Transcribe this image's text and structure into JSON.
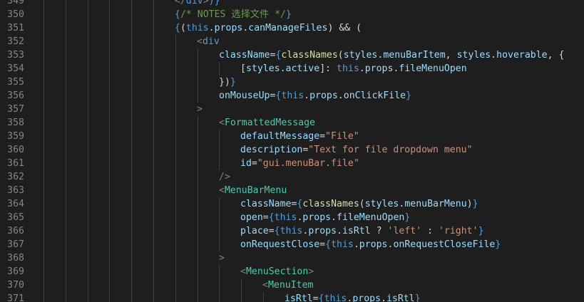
{
  "editor": {
    "lines": [
      {
        "num": "349",
        "indent": 6,
        "tokens": [
          {
            "t": "</",
            "c": "tagp"
          },
          {
            "t": "div",
            "c": "kw"
          },
          {
            "t": ">",
            "c": "tagp"
          },
          {
            "t": ")}",
            "c": "brace"
          }
        ]
      },
      {
        "num": "350",
        "indent": 6,
        "tokens": [
          {
            "t": "{",
            "c": "brace"
          },
          {
            "t": "/* NOTES 选择文件 */",
            "c": "comment"
          },
          {
            "t": "}",
            "c": "brace"
          }
        ]
      },
      {
        "num": "351",
        "indent": 6,
        "tokens": [
          {
            "t": "{",
            "c": "brace"
          },
          {
            "t": "(",
            "c": "paren"
          },
          {
            "t": "this",
            "c": "kw"
          },
          {
            "t": ".",
            "c": "punct"
          },
          {
            "t": "props",
            "c": "prop"
          },
          {
            "t": ".",
            "c": "punct"
          },
          {
            "t": "canManageFiles",
            "c": "prop"
          },
          {
            "t": ")",
            "c": "paren"
          },
          {
            "t": " && (",
            "c": "op"
          }
        ]
      },
      {
        "num": "352",
        "indent": 7,
        "tokens": [
          {
            "t": "<",
            "c": "tagp"
          },
          {
            "t": "div",
            "c": "kw"
          }
        ]
      },
      {
        "num": "353",
        "indent": 8,
        "tokens": [
          {
            "t": "className",
            "c": "attr"
          },
          {
            "t": "=",
            "c": "op"
          },
          {
            "t": "{",
            "c": "brace"
          },
          {
            "t": "classNames",
            "c": "func"
          },
          {
            "t": "(",
            "c": "paren"
          },
          {
            "t": "styles",
            "c": "prop"
          },
          {
            "t": ".",
            "c": "punct"
          },
          {
            "t": "menuBarItem",
            "c": "prop"
          },
          {
            "t": ", ",
            "c": "punct"
          },
          {
            "t": "styles",
            "c": "prop"
          },
          {
            "t": ".",
            "c": "punct"
          },
          {
            "t": "hoverable",
            "c": "prop"
          },
          {
            "t": ", {",
            "c": "punct"
          }
        ]
      },
      {
        "num": "354",
        "indent": 9,
        "tokens": [
          {
            "t": "[",
            "c": "punct"
          },
          {
            "t": "styles",
            "c": "prop"
          },
          {
            "t": ".",
            "c": "punct"
          },
          {
            "t": "active",
            "c": "prop"
          },
          {
            "t": "]: ",
            "c": "punct"
          },
          {
            "t": "this",
            "c": "kw"
          },
          {
            "t": ".",
            "c": "punct"
          },
          {
            "t": "props",
            "c": "prop"
          },
          {
            "t": ".",
            "c": "punct"
          },
          {
            "t": "fileMenuOpen",
            "c": "prop"
          }
        ]
      },
      {
        "num": "355",
        "indent": 8,
        "tokens": [
          {
            "t": "})",
            "c": "punct"
          },
          {
            "t": "}",
            "c": "brace"
          }
        ]
      },
      {
        "num": "356",
        "indent": 8,
        "tokens": [
          {
            "t": "onMouseUp",
            "c": "attr"
          },
          {
            "t": "=",
            "c": "op"
          },
          {
            "t": "{",
            "c": "brace"
          },
          {
            "t": "this",
            "c": "kw"
          },
          {
            "t": ".",
            "c": "punct"
          },
          {
            "t": "props",
            "c": "prop"
          },
          {
            "t": ".",
            "c": "punct"
          },
          {
            "t": "onClickFile",
            "c": "prop"
          },
          {
            "t": "}",
            "c": "brace"
          }
        ]
      },
      {
        "num": "357",
        "indent": 7,
        "tokens": [
          {
            "t": ">",
            "c": "tagp"
          }
        ]
      },
      {
        "num": "358",
        "indent": 8,
        "tokens": [
          {
            "t": "<",
            "c": "tagp"
          },
          {
            "t": "FormattedMessage",
            "c": "tag"
          }
        ]
      },
      {
        "num": "359",
        "indent": 9,
        "tokens": [
          {
            "t": "defaultMessage",
            "c": "attr"
          },
          {
            "t": "=",
            "c": "op"
          },
          {
            "t": "\"File\"",
            "c": "str"
          }
        ]
      },
      {
        "num": "360",
        "indent": 9,
        "tokens": [
          {
            "t": "description",
            "c": "attr"
          },
          {
            "t": "=",
            "c": "op"
          },
          {
            "t": "\"Text for file dropdown menu\"",
            "c": "str"
          }
        ]
      },
      {
        "num": "361",
        "indent": 9,
        "tokens": [
          {
            "t": "id",
            "c": "attr"
          },
          {
            "t": "=",
            "c": "op"
          },
          {
            "t": "\"gui.menuBar.file\"",
            "c": "str"
          }
        ]
      },
      {
        "num": "362",
        "indent": 8,
        "tokens": [
          {
            "t": "/>",
            "c": "tagp"
          }
        ]
      },
      {
        "num": "363",
        "indent": 8,
        "tokens": [
          {
            "t": "<",
            "c": "tagp"
          },
          {
            "t": "MenuBarMenu",
            "c": "tag"
          }
        ]
      },
      {
        "num": "364",
        "indent": 9,
        "tokens": [
          {
            "t": "className",
            "c": "attr"
          },
          {
            "t": "=",
            "c": "op"
          },
          {
            "t": "{",
            "c": "brace"
          },
          {
            "t": "classNames",
            "c": "func"
          },
          {
            "t": "(",
            "c": "paren"
          },
          {
            "t": "styles",
            "c": "prop"
          },
          {
            "t": ".",
            "c": "punct"
          },
          {
            "t": "menuBarMenu",
            "c": "prop"
          },
          {
            "t": ")",
            "c": "paren"
          },
          {
            "t": "}",
            "c": "brace"
          }
        ]
      },
      {
        "num": "365",
        "indent": 9,
        "tokens": [
          {
            "t": "open",
            "c": "attr"
          },
          {
            "t": "=",
            "c": "op"
          },
          {
            "t": "{",
            "c": "brace"
          },
          {
            "t": "this",
            "c": "kw"
          },
          {
            "t": ".",
            "c": "punct"
          },
          {
            "t": "props",
            "c": "prop"
          },
          {
            "t": ".",
            "c": "punct"
          },
          {
            "t": "fileMenuOpen",
            "c": "prop"
          },
          {
            "t": "}",
            "c": "brace"
          }
        ]
      },
      {
        "num": "366",
        "indent": 9,
        "tokens": [
          {
            "t": "place",
            "c": "attr"
          },
          {
            "t": "=",
            "c": "op"
          },
          {
            "t": "{",
            "c": "brace"
          },
          {
            "t": "this",
            "c": "kw"
          },
          {
            "t": ".",
            "c": "punct"
          },
          {
            "t": "props",
            "c": "prop"
          },
          {
            "t": ".",
            "c": "punct"
          },
          {
            "t": "isRtl",
            "c": "prop"
          },
          {
            "t": " ? ",
            "c": "op"
          },
          {
            "t": "'left'",
            "c": "str"
          },
          {
            "t": " : ",
            "c": "op"
          },
          {
            "t": "'right'",
            "c": "str"
          },
          {
            "t": "}",
            "c": "brace"
          }
        ]
      },
      {
        "num": "367",
        "indent": 9,
        "tokens": [
          {
            "t": "onRequestClose",
            "c": "attr"
          },
          {
            "t": "=",
            "c": "op"
          },
          {
            "t": "{",
            "c": "brace"
          },
          {
            "t": "this",
            "c": "kw"
          },
          {
            "t": ".",
            "c": "punct"
          },
          {
            "t": "props",
            "c": "prop"
          },
          {
            "t": ".",
            "c": "punct"
          },
          {
            "t": "onRequestCloseFile",
            "c": "prop"
          },
          {
            "t": "}",
            "c": "brace"
          }
        ]
      },
      {
        "num": "368",
        "indent": 8,
        "tokens": [
          {
            "t": ">",
            "c": "tagp"
          }
        ]
      },
      {
        "num": "369",
        "indent": 9,
        "tokens": [
          {
            "t": "<",
            "c": "tagp"
          },
          {
            "t": "MenuSection",
            "c": "tag"
          },
          {
            "t": ">",
            "c": "tagp"
          }
        ]
      },
      {
        "num": "370",
        "indent": 10,
        "tokens": [
          {
            "t": "<",
            "c": "tagp"
          },
          {
            "t": "MenuItem",
            "c": "tag"
          }
        ]
      },
      {
        "num": "371",
        "indent": 11,
        "tokens": [
          {
            "t": "isRtl",
            "c": "attr"
          },
          {
            "t": "=",
            "c": "op"
          },
          {
            "t": "{",
            "c": "brace"
          },
          {
            "t": "this",
            "c": "kw"
          },
          {
            "t": ".",
            "c": "punct"
          },
          {
            "t": "props",
            "c": "prop"
          },
          {
            "t": ".",
            "c": "punct"
          },
          {
            "t": "isRtl",
            "c": "prop"
          },
          {
            "t": "}",
            "c": "brace"
          }
        ]
      }
    ]
  }
}
